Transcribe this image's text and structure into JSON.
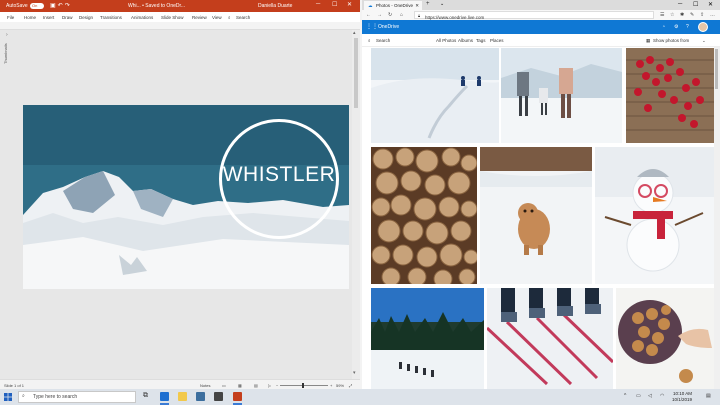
{
  "powerpoint": {
    "autosave_label": "AutoSave",
    "autosave_state": "On",
    "document_title": "Whi... • Saved to OneDr...",
    "user_name": "Daniella Duarte",
    "menu": [
      "File",
      "Home",
      "Insert",
      "Draw",
      "Design",
      "Transitions",
      "Animations",
      "Slide Show",
      "Review",
      "View"
    ],
    "search_label": "Search",
    "thumbnails_label": "Thumbnails",
    "slide_title": "WHISTLER",
    "status": {
      "slide_counter": "Slide 1 of 1",
      "notes_label": "Notes",
      "zoom": "59%"
    }
  },
  "edge": {
    "tab_title": "Photos - OneDrive",
    "url": "https://www.onedrive.live.com",
    "onedrive": {
      "app_name": "OneDrive",
      "search_label": "Search",
      "filters": [
        "All Photos",
        "Albums",
        "Tags",
        "Places"
      ],
      "show_photos_from": "Show photos from"
    }
  },
  "taskbar": {
    "search_placeholder": "Type here to search",
    "time": "10:10 AM",
    "date": "10/1/2019"
  },
  "colors": {
    "ppt_accent": "#c43e1c",
    "onedrive_accent": "#0f78d4",
    "taskbar": "#dde3ea"
  }
}
